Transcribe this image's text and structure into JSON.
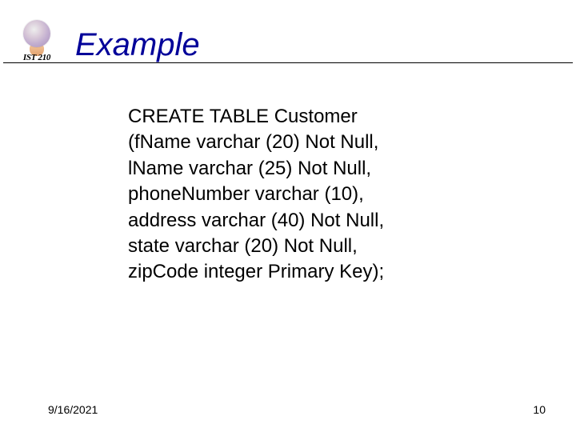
{
  "logo": {
    "label": "IST 210"
  },
  "title": "Example",
  "code": {
    "l1": "CREATE TABLE Customer",
    "l2": "(fName varchar (20) Not Null,",
    "l3": "lName varchar (25) Not Null,",
    "l4": "phoneNumber varchar (10),",
    "l5": "address varchar (40) Not Null,",
    "l6": "state varchar (20) Not Null,",
    "l7": "zipCode integer Primary Key);"
  },
  "footer": {
    "date": "9/16/2021",
    "page": "10"
  }
}
